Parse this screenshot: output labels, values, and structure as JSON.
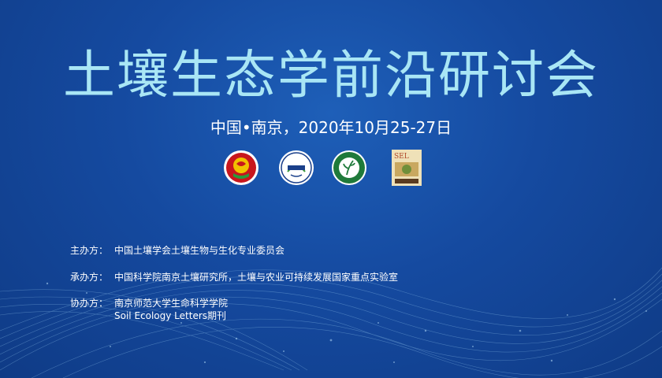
{
  "title": "土壤生态学前沿研讨会",
  "subtitle": "中国•南京，2020年10月25-27日",
  "logos": [
    {
      "icon": "red-emblem-logo-icon"
    },
    {
      "icon": "isscas-logo-icon"
    },
    {
      "icon": "green-plant-logo-icon"
    },
    {
      "icon": "sel-journal-cover-icon",
      "text": "SEL"
    }
  ],
  "organizers": {
    "host_label": "主办方：",
    "host_value": "中国土壤学会土壤生物与生化专业委员会",
    "co_host_label": "承办方：",
    "co_host_value": "中国科学院南京土壤研究所，土壤与农业可持续发展国家重点实验室",
    "assist_label": "协办方：",
    "assist_value_1": "南京师范大学生命科学学院",
    "assist_value_2": "Soil Ecology Letters期刊"
  },
  "colors": {
    "background": "#154aa0",
    "title": "#a9e6f5",
    "text": "#ffffff"
  }
}
